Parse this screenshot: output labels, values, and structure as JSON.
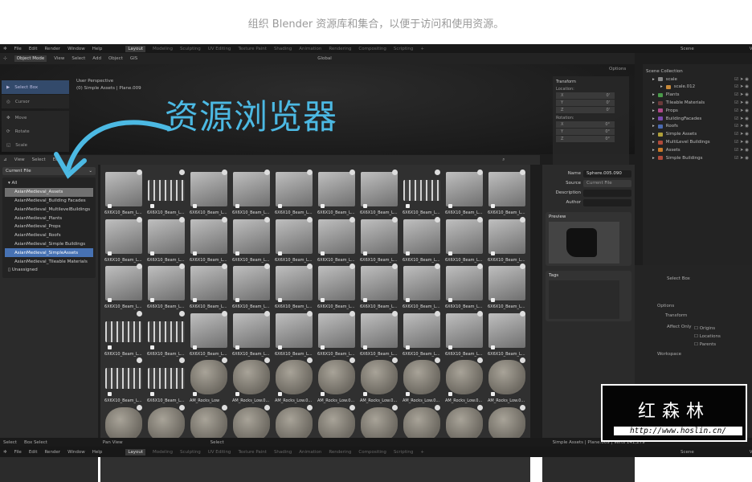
{
  "page": {
    "subtitle": "组织 Blender 资源库和集合，以便于访问和使用资源。",
    "annotation": "资源浏览器",
    "accent": "#4cb9e3"
  },
  "topbar": {
    "menus": [
      "File",
      "Edit",
      "Render",
      "Window",
      "Help"
    ],
    "workspaces": [
      "Layout",
      "Modeling",
      "Sculpting",
      "UV Editing",
      "Texture Paint",
      "Shading",
      "Animation",
      "Rendering",
      "Compositing",
      "Scripting",
      "+"
    ],
    "scene": "Scene",
    "view_layer": "View Layer"
  },
  "header": {
    "mode": "Object Mode",
    "menus": [
      "View",
      "Select",
      "Add",
      "Object",
      "GIS"
    ],
    "orientation": "Global",
    "options": "Options"
  },
  "viewport": {
    "tools": [
      "Select Box",
      "Cursor",
      "Move",
      "Rotate",
      "Scale"
    ],
    "perspective": "User Perspective",
    "context": "(0) Simple Assets | Plane.009"
  },
  "npanel": {
    "tab": "Transform",
    "location": "Location:",
    "rotation": "Rotation:",
    "axes": [
      "X",
      "Y",
      "Z"
    ],
    "loc_values": [
      "0'",
      "0'",
      "0'"
    ],
    "rot_values": [
      "0°",
      "0°",
      "0°"
    ]
  },
  "outliner": {
    "root": "Scene Collection",
    "items": [
      {
        "name": "scale",
        "color": "#888"
      },
      {
        "name": "scale.012",
        "color": "#c98a3a"
      },
      {
        "name": "Plants",
        "color": "#4a9a4a"
      },
      {
        "name": "Tileable Materials",
        "color": "#6a3a3a"
      },
      {
        "name": "Props",
        "color": "#b04a8a"
      },
      {
        "name": "BuildingFacades",
        "color": "#7a4ab0"
      },
      {
        "name": "Roofs",
        "color": "#4a6ab0"
      },
      {
        "name": "Simple Assets",
        "color": "#b0a03a"
      },
      {
        "name": "MultiLevel Buildings",
        "color": "#b04a3a"
      },
      {
        "name": "Assets",
        "color": "#c97a2a"
      },
      {
        "name": "Simple Buildings",
        "color": "#b04a3a"
      }
    ]
  },
  "asset_browser": {
    "menus": [
      "View",
      "Select",
      "Edit"
    ],
    "library": "Current File",
    "all": "All",
    "categories": [
      "AsianMedieval_Assets",
      "AsianMedieval_Building Facades",
      "AsianMedieval_MultilevelBuildings",
      "AsianMedieval_Plants",
      "AsianMedieval_Props",
      "AsianMedieval_Roofs",
      "AsianMedieval_Simple Buildings",
      "AsianMedieval_SimpleAssets",
      "AsianMedieval_Tileable Materials"
    ],
    "active_category": 0,
    "selected_category": 7,
    "unassigned": "Unassigned",
    "beam_label": "6X6X10_Beam_L...",
    "rows": [
      [
        "6X6X10_Beam_L...",
        "6X6X10_Beam_L...",
        "6X6X10_Beam_L...",
        "6X6X10_Beam_L...",
        "6X6X10_Beam_L...",
        "6X6X10_Beam_L...",
        "6X6X10_Beam_L...",
        "6X6X10_Beam_L...",
        "6X6X10_Beam_L...",
        "6X6X10_Beam_L..."
      ],
      [
        "6X6X10_Beam_L...",
        "6X6X10_Beam_L...",
        "6X6X10_Beam_L...",
        "6X6X10_Beam_L...",
        "6X6X10_Beam_L...",
        "6X6X10_Beam_L...",
        "6X6X10_Beam_L...",
        "6X6X10_Beam_L...",
        "6X6X10_Beam_L...",
        "6X6X10_Beam_L..."
      ],
      [
        "6X6X10_Beam_L...",
        "6X6X10_Beam_L...",
        "6X6X10_Beam_L...",
        "6X6X10_Beam_L...",
        "6X6X10_Beam_L...",
        "6X6X10_Beam_L...",
        "6X6X10_Beam_L...",
        "6X6X10_Beam_L...",
        "6X6X10_Beam_L...",
        "6X6X10_Beam_L..."
      ],
      [
        "6X6X10_Beam_L...",
        "6X6X10_Beam_L...",
        "6X6X10_Beam_L...",
        "6X6X10_Beam_L...",
        "6X6X10_Beam_L...",
        "6X6X10_Beam_L...",
        "6X6X10_Beam_L...",
        "6X6X10_Beam_L...",
        "6X6X10_Beam_L...",
        "6X6X10_Beam_L..."
      ],
      [
        "6X6X10_Beam_L...",
        "6X6X10_Beam_L...",
        "AM_Rocks_Low",
        "AM_Rocks_Low.0...",
        "AM_Rocks_Low.0...",
        "AM_Rocks_Low.0...",
        "AM_Rocks_Low.0...",
        "AM_Rocks_Low.0...",
        "AM_Rocks_Low.0...",
        "AM_Rocks_Low.0..."
      ],
      [
        "",
        "",
        "",
        "",
        "",
        "",
        "",
        "",
        "",
        ""
      ]
    ]
  },
  "sidebar": {
    "name_label": "Name",
    "name": "Sphere.005.090",
    "source_label": "Source",
    "source": "Current File",
    "description_label": "Description",
    "author_label": "Author",
    "preview": "Preview",
    "tags": "Tags"
  },
  "properties": {
    "tool": "Select Box",
    "options": "Options",
    "transform": "Transform",
    "affect_only": "Affect Only",
    "checks": [
      "Origins",
      "Locations",
      "Parents"
    ],
    "workspace": "Workspace"
  },
  "status": {
    "items": [
      "Select",
      "Box Select",
      "Pan View",
      "Select"
    ],
    "info": "Simple Assets | Plane.009 | Verts 141,279"
  },
  "watermark": {
    "name": "红森林",
    "url": "http://www.hoslin.cn/"
  }
}
